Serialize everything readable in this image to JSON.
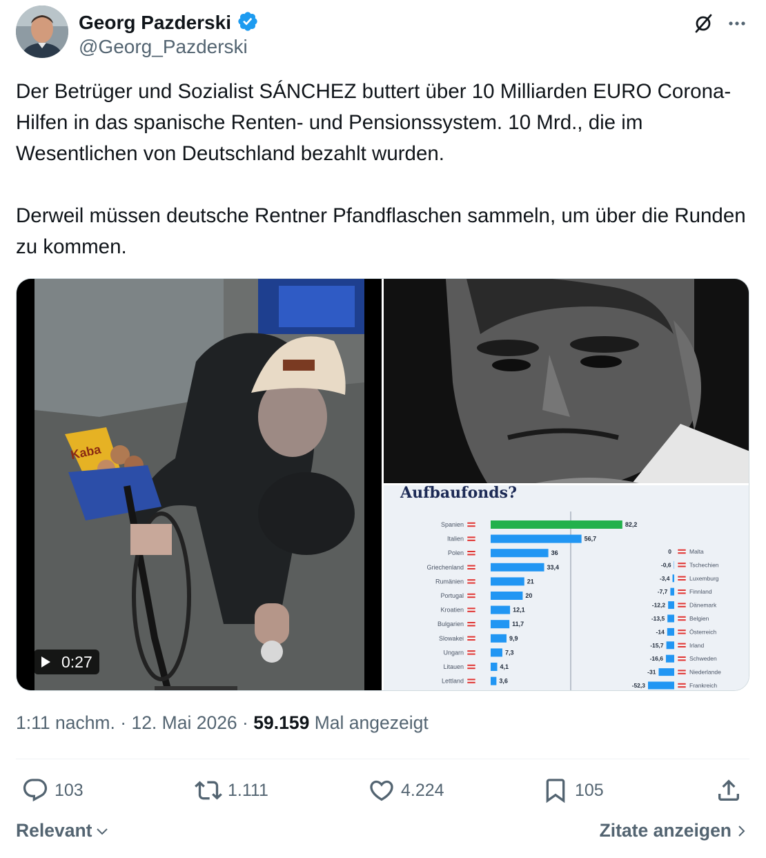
{
  "author": {
    "name": "Georg Pazderski",
    "handle": "@Georg_Pazderski"
  },
  "tweet": {
    "paragraphs": [
      "Der Betrüger und Sozialist SÁNCHEZ buttert über 10 Milliarden EURO Corona-Hilfen in das spanische Renten- und Pensionssystem. 10 Mrd., die im Wesentlichen von Deutschland bezahlt wurden.",
      "Derweil müssen deutsche Rentner Pfandflaschen sammeln, um über die Runden zu kommen."
    ]
  },
  "media": {
    "video_duration": "0:27",
    "chart_title": "Aufbaufonds?"
  },
  "chart_data": {
    "type": "bar",
    "title": "Aufbaufonds?",
    "panels": [
      {
        "categories": [
          "Spanien",
          "Italien",
          "Polen",
          "Griechenland",
          "Rumänien",
          "Portugal",
          "Kroatien",
          "Bulgarien",
          "Slowakei",
          "Ungarn",
          "Litauen",
          "Lettland"
        ],
        "values": [
          82.2,
          56.7,
          36,
          33.4,
          21,
          20,
          12.1,
          11.7,
          9.9,
          7.3,
          4.1,
          3.6
        ],
        "value_labels": [
          "82,2",
          "56,7",
          "36",
          "33,4",
          "21",
          "20",
          "12,1",
          "11,7",
          "9,9",
          "7,3",
          "4,1",
          "3,6"
        ],
        "highlight_index": 0
      },
      {
        "categories": [
          "Malta",
          "Tschechien",
          "Luxemburg",
          "Finnland",
          "Dänemark",
          "Belgien",
          "Österreich",
          "Irland",
          "Schweden",
          "Niederlande",
          "Frankreich"
        ],
        "values": [
          0,
          -0.6,
          -3.4,
          -7.7,
          -12.2,
          -13.5,
          -14,
          -15.7,
          -16.6,
          -31,
          -52.3
        ],
        "value_labels": [
          "0",
          "-0,6",
          "-3,4",
          "-7,7",
          "-12,2",
          "-13,5",
          "-14",
          "-15,7",
          "-16,6",
          "-31",
          "-52,3"
        ]
      }
    ],
    "colors": {
      "bar": "#2196f3",
      "highlight": "#22b14c"
    }
  },
  "timestamp": {
    "time": "1:11 nachm.",
    "separator": "·",
    "date": "12. Mai 2026",
    "views_count": "59.159",
    "views_label": "Mal angezeigt"
  },
  "actions": {
    "replies": "103",
    "reposts": "1.111",
    "likes": "4.224",
    "bookmarks": "105"
  },
  "footer": {
    "sort_label": "Relevant",
    "quotes_label": "Zitate anzeigen"
  },
  "colors": {
    "text": "#0f1419",
    "secondary": "#536471",
    "verified": "#1d9bf0"
  },
  "icons": [
    "verified-badge-icon",
    "grok-icon",
    "more-icon",
    "play-icon",
    "reply-icon",
    "repost-icon",
    "like-icon",
    "bookmark-icon",
    "share-icon",
    "chevron-down-icon",
    "chevron-right-icon"
  ]
}
